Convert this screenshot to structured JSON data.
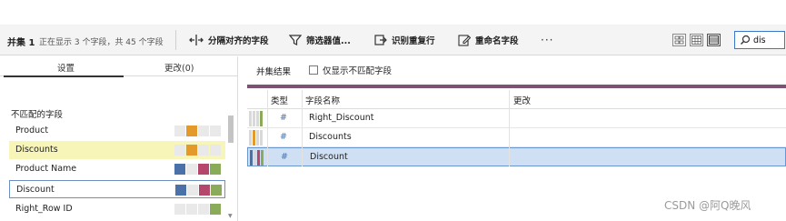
{
  "toolbar": {
    "title": "并集 1",
    "status": "正在显示 3 个字段，共 45 个字段",
    "btn_split": "分隔对齐的字段",
    "btn_filter": "筛选器值...",
    "btn_dup": "识别重复行",
    "btn_rename": "重命名字段",
    "more": "···"
  },
  "search": {
    "value": "dis"
  },
  "left": {
    "tab_settings": "设置",
    "tab_changes": "更改(0)",
    "section": "不匹配的字段",
    "fields": [
      {
        "name": "Product",
        "colors": [
          "#e9e9e9",
          "#e39a2b",
          "#e9e9e9",
          "#e9e9e9"
        ]
      },
      {
        "name": "Discounts",
        "colors": [
          "#e9e9e9",
          "#e39a2b",
          "#e9e9e9",
          "#e9e9e9"
        ]
      },
      {
        "name": "Product Name",
        "colors": [
          "#4b72a8",
          "#e9e9e9",
          "#b5476d",
          "#8aac5a"
        ]
      },
      {
        "name": "Discount",
        "colors": [
          "#4b72a8",
          "#e9e9e9",
          "#b5476d",
          "#8aac5a"
        ]
      },
      {
        "name": "Right_Row ID",
        "colors": [
          "#e9e9e9",
          "#e9e9e9",
          "#e9e9e9",
          "#8aac5a"
        ]
      }
    ]
  },
  "right": {
    "title": "并集结果",
    "checkbox_label": "仅显示不匹配字段",
    "col_type": "类型",
    "col_name": "字段名称",
    "col_change": "更改",
    "rows": [
      {
        "type": "#",
        "name": "Right_Discount",
        "stripes": [
          "#d9d9d9",
          "#d9d9d9",
          "#d9d9d9",
          "#8aac5a"
        ]
      },
      {
        "type": "#",
        "name": "Discounts",
        "stripes": [
          "#d9d9d9",
          "#e39a2b",
          "#d9d9d9",
          "#d9d9d9"
        ]
      },
      {
        "type": "#",
        "name": "Discount",
        "stripes": [
          "#4b72a8",
          "#d9d9d9",
          "#b5476d",
          "#8aac5a"
        ]
      }
    ]
  },
  "watermark": "CSDN @阿Q晚风"
}
